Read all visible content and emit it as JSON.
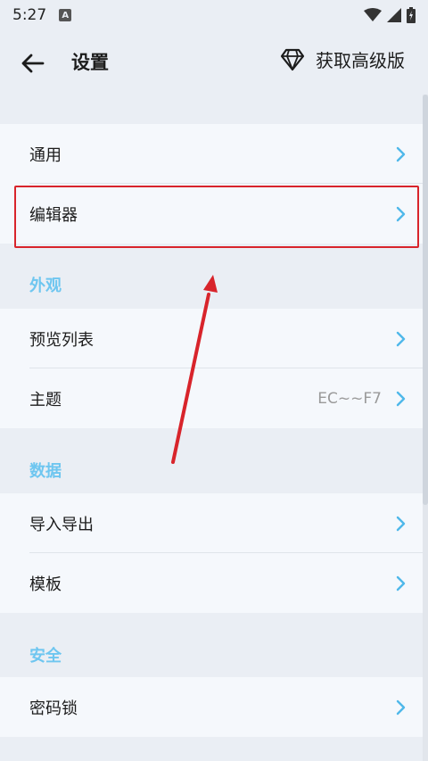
{
  "status_bar": {
    "time": "5:27",
    "notification_letter": "A"
  },
  "app_bar": {
    "title": "设置",
    "premium_label": "获取高级版"
  },
  "general_group": {
    "items": [
      {
        "label": "通用"
      },
      {
        "label": "编辑器"
      }
    ]
  },
  "appearance_group": {
    "header": "外观",
    "items": [
      {
        "label": "预览列表"
      },
      {
        "label": "主题",
        "value": "EC~~F7"
      }
    ]
  },
  "data_group": {
    "header": "数据",
    "items": [
      {
        "label": "导入导出"
      },
      {
        "label": "模板"
      }
    ]
  },
  "security_group": {
    "header": "安全",
    "items": [
      {
        "label": "密码锁"
      }
    ]
  },
  "colors": {
    "accent": "#6ec6f0",
    "chevron": "#4fb8ea",
    "highlight": "#d8242b",
    "background": "#eaeef4",
    "card": "#f5f8fc"
  },
  "icons": {
    "back": "arrow-left-icon",
    "premium": "diamond-icon",
    "row_chevron": "chevron-right-icon",
    "wifi": "wifi-icon",
    "signal": "signal-icon",
    "battery": "battery-icon"
  }
}
